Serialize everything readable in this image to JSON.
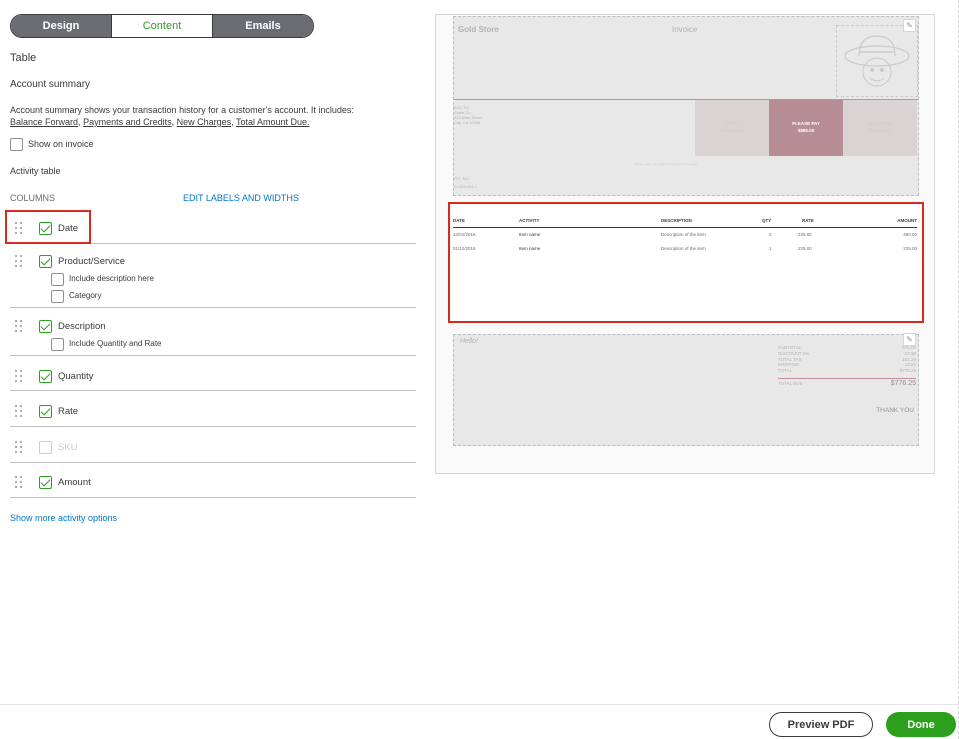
{
  "tabs": [
    "Design",
    "Content",
    "Emails"
  ],
  "section_title": "Table",
  "account_summary": {
    "title": "Account summary",
    "desc_prefix": "Account summary shows your transaction history for a customer's account. It includes:",
    "items": [
      "Balance Forward",
      "Payments and Credits",
      "New Charges",
      "Total Amount Due."
    ],
    "show_on_invoice": "Show on invoice"
  },
  "activity_table": "Activity table",
  "columns_label": "COLUMNS",
  "edit_labels_link": "EDIT LABELS AND WIDTHS",
  "columns": {
    "date": "Date",
    "product": "Product/Service",
    "include_desc": "Include description here",
    "category": "Category",
    "description": "Description",
    "include_qty": "Include Quantity and Rate",
    "quantity": "Quantity",
    "rate": "Rate",
    "sku": "SKU",
    "amount": "Amount"
  },
  "more_link": "Show more activity options",
  "invoice": {
    "company": "Gold Store",
    "title": "Invoice",
    "bill_to": "BILL TO",
    "bill_lines": [
      "Smith Co.",
      "123 Main Street",
      "City, CA 12345"
    ],
    "date_label": "DATE",
    "date_value": "01/12/2016",
    "please_pay": "PLEASE PAY",
    "pay_amount": "$885.00",
    "due_label": "DUE DATE",
    "due_value": "02/12/2016",
    "note": "Please make your payment before the due date",
    "po_label": "P.O. NO.",
    "po_value": "CUS01004-1",
    "headers": [
      "DATE",
      "ACTIVITY",
      "DESCRIPTION",
      "QTY",
      "RATE",
      "AMOUNT"
    ],
    "rows": [
      [
        "12/01/2016",
        "Item name",
        "Description of the item",
        "2",
        "225.00",
        "450.00"
      ],
      [
        "01/12/2016",
        "Item name",
        "Description of the item",
        "1",
        "225.00",
        "225.00"
      ]
    ],
    "hello": "Hello!",
    "totals": [
      [
        "SUBTOTAL",
        "675.00"
      ],
      [
        "DISCOUNT 2%",
        "-13.50"
      ],
      [
        "TOTAL TAX",
        "101.25"
      ],
      [
        "SHIPPING",
        "13.50"
      ],
      [
        "TOTAL",
        "$776.25"
      ]
    ],
    "total_due_label": "TOTAL DUE",
    "total_due_value": "$776.25",
    "thank_you": "THANK YOU"
  },
  "footer": {
    "preview_pdf": "Preview PDF",
    "done": "Done"
  }
}
